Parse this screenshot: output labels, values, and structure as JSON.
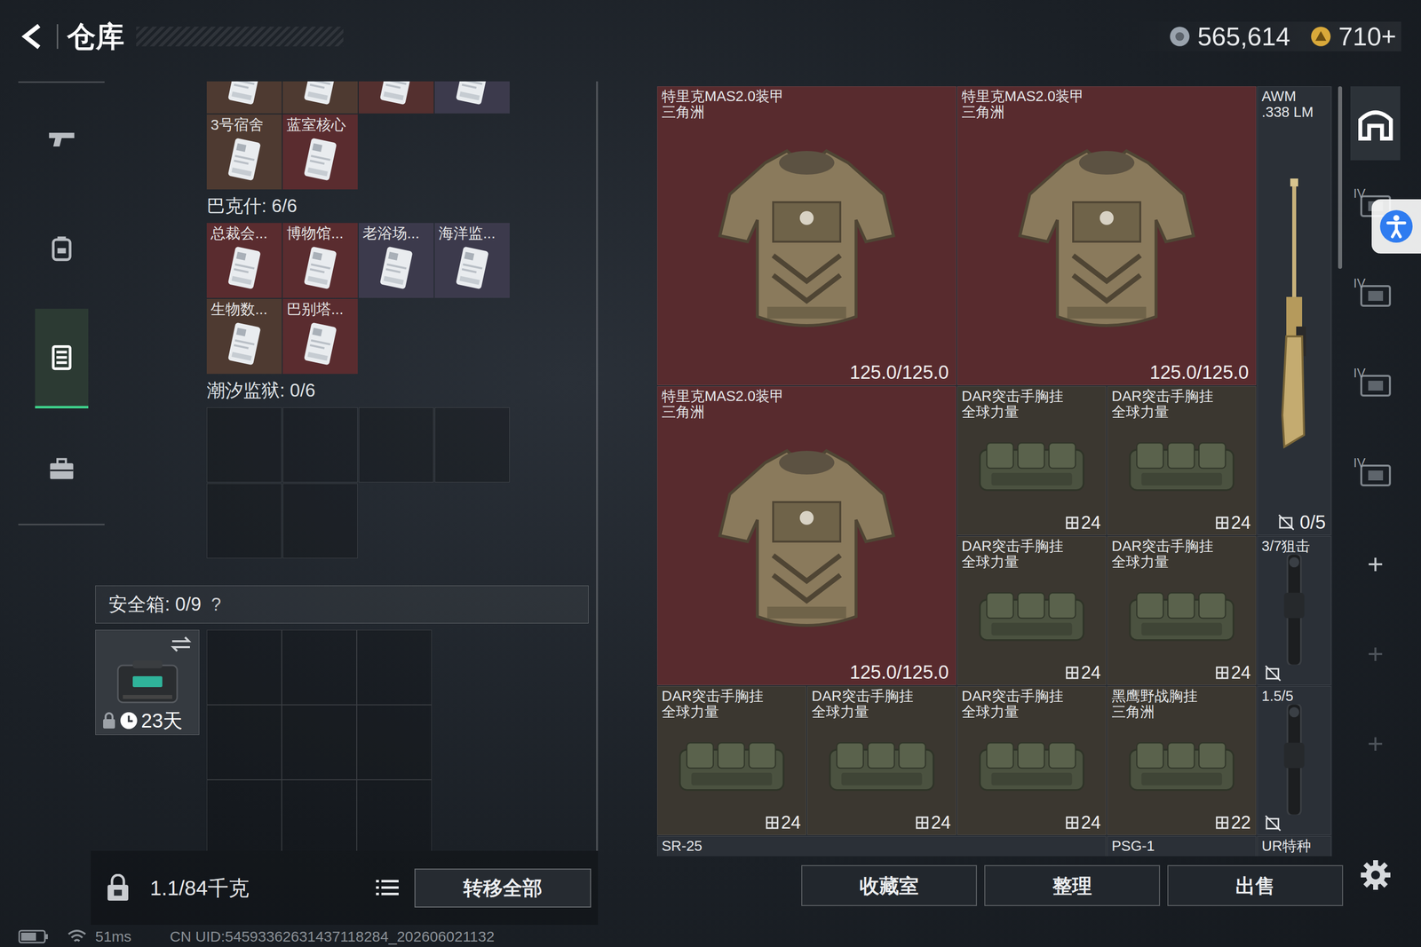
{
  "header": {
    "title": "仓库",
    "currency": [
      {
        "amount": "565,614",
        "kind": "coin"
      },
      {
        "amount": "710+",
        "kind": "gold"
      }
    ]
  },
  "sidebar": {
    "items": [
      {
        "selected": false
      },
      {
        "selected": false
      },
      {
        "selected": true
      },
      {
        "selected": false
      }
    ]
  },
  "key_sections": [
    {
      "cards": [
        {
          "color": "#4e3a31"
        },
        {
          "color": "#4e3a31"
        },
        {
          "color": "#54302f"
        },
        {
          "color": "#3c3a4c"
        },
        {
          "label": "3号宿舍",
          "color": "#4e3a31"
        },
        {
          "label": "蓝室核心",
          "color": "#5a2c2f"
        }
      ]
    },
    {
      "title": "巴克什: 6/6",
      "cards": [
        {
          "label": "总裁会...",
          "color": "#5a2c2f"
        },
        {
          "label": "博物馆...",
          "color": "#5a2c2f"
        },
        {
          "label": "老浴场...",
          "color": "#3c3a4c"
        },
        {
          "label": "海洋监...",
          "color": "#3c3a4c"
        },
        {
          "label": "生物数...",
          "color": "#4e3a31"
        },
        {
          "label": "巴别塔...",
          "color": "#5a2c2f"
        }
      ]
    },
    {
      "title": "潮汐监狱: 0/6",
      "slots": [
        {
          "filled": false
        },
        {
          "filled": false
        },
        {
          "filled": false
        },
        {
          "filled": false
        },
        {
          "filled": false
        },
        {
          "filled": false
        }
      ]
    }
  ],
  "safe_box": {
    "label": "安全箱: 0/9",
    "help": "?",
    "timer": "23天",
    "locked": true,
    "slots": [
      {
        "filled": false
      },
      {
        "filled": false
      },
      {
        "filled": false
      },
      {
        "filled": false
      },
      {
        "filled": false
      },
      {
        "filled": false
      },
      {
        "filled": false
      },
      {
        "filled": false
      },
      {
        "filled": false
      }
    ]
  },
  "weight": {
    "text": "1.1/84千克"
  },
  "transfer_button": "转移全部",
  "stash": {
    "items": [
      {
        "kind": "armor",
        "name": "特里克MAS2.0装甲",
        "brand": "三角洲",
        "reading": "125.0/125.0",
        "color": "#582b2e"
      },
      {
        "kind": "armor",
        "name": "特里克MAS2.0装甲",
        "brand": "三角洲",
        "reading": "125.0/125.0",
        "color": "#582b2e"
      },
      {
        "kind": "sniper-rifle",
        "name": "AWM",
        "brand": ".338 LM",
        "reading": "0/5",
        "color": "#2b3037"
      },
      {
        "kind": "armor",
        "name": "特里克MAS2.0装甲",
        "brand": "三角洲",
        "reading": "125.0/125.0",
        "color": "#582b2e"
      },
      {
        "kind": "rig",
        "name": "DAR突击手胸挂",
        "brand": "全球力量",
        "reading": "24",
        "color": "#3b3730"
      },
      {
        "kind": "rig",
        "name": "DAR突击手胸挂",
        "brand": "全球力量",
        "reading": "24",
        "color": "#3b3730"
      },
      {
        "kind": "rig",
        "name": "DAR突击手胸挂",
        "brand": "全球力量",
        "reading": "24",
        "color": "#3b3730"
      },
      {
        "kind": "rig",
        "name": "DAR突击手胸挂",
        "brand": "全球力量",
        "reading": "24",
        "color": "#3b3730"
      },
      {
        "kind": "scope",
        "name": "3/7狙击",
        "color": "#2b3037"
      },
      {
        "kind": "rig",
        "name": "DAR突击手胸挂",
        "brand": "全球力量",
        "reading": "24",
        "color": "#3b3730"
      },
      {
        "kind": "rig",
        "name": "DAR突击手胸挂",
        "brand": "全球力量",
        "reading": "24",
        "color": "#3b3730"
      },
      {
        "kind": "rig",
        "name": "DAR突击手胸挂",
        "brand": "全球力量",
        "reading": "24",
        "color": "#3b3730"
      },
      {
        "kind": "rig",
        "name": "黑鹰野战胸挂",
        "brand": "三角洲",
        "reading": "22",
        "color": "#3b3730"
      },
      {
        "kind": "scope",
        "name": "1.5/5",
        "color": "#2b3037"
      },
      {
        "kind": "marksman-rifle",
        "name": "SR-25",
        "color": "#2b3037"
      },
      {
        "kind": "sniper-rifle-cut",
        "name": "PSG-1",
        "color": "#2b3037"
      },
      {
        "kind": "attachment",
        "name": "UR特种",
        "color": "#2b3037"
      }
    ]
  },
  "actions": [
    "收藏室",
    "整理",
    "出售"
  ],
  "rail": [
    {
      "kind": "home",
      "selected": true
    },
    {
      "kind": "tier",
      "label": "IV",
      "selected": false
    },
    {
      "kind": "tier",
      "label": "IV",
      "selected": false
    },
    {
      "kind": "tier",
      "label": "IV",
      "selected": false
    },
    {
      "kind": "tier",
      "label": "IV",
      "selected": false
    },
    {
      "kind": "add",
      "label": "+",
      "disabled": false
    },
    {
      "kind": "add",
      "label": "+",
      "disabled": true
    },
    {
      "kind": "add",
      "label": "+",
      "disabled": true
    }
  ],
  "status_bar": {
    "ping": "51ms",
    "uid": "CN UID:54593362631437118284_202606021132"
  }
}
